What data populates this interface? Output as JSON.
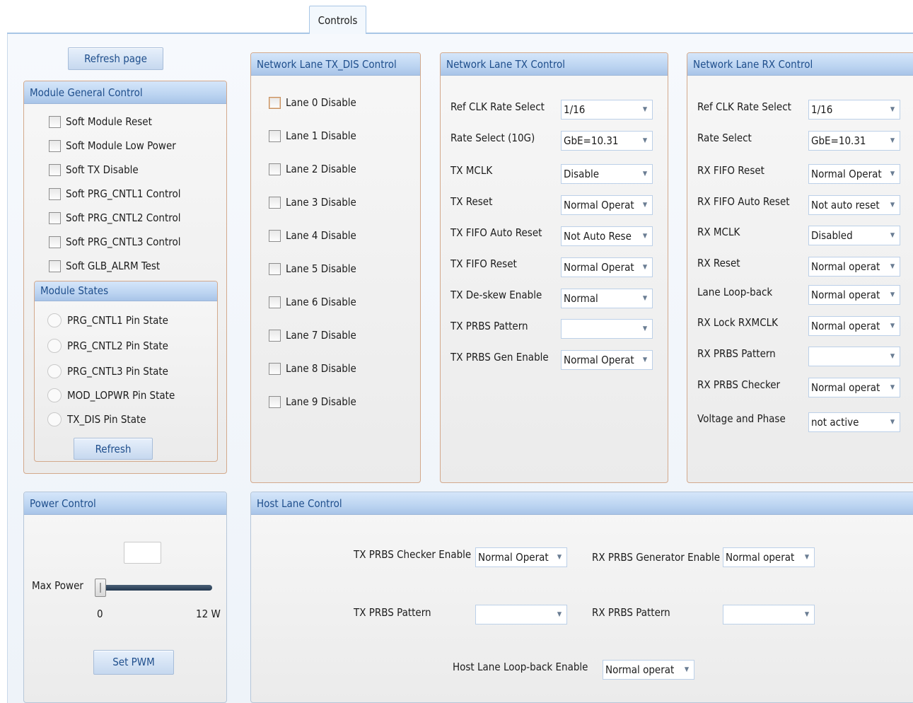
{
  "tabs": [
    {
      "label": "Controls"
    }
  ],
  "refresh_page_label": "Refresh page",
  "module_general": {
    "title": "Module General Control",
    "checkboxes": [
      "Soft Module Reset",
      "Soft Module Low Power",
      "Soft TX Disable",
      "Soft PRG_CNTL1 Control",
      "Soft PRG_CNTL2 Control",
      "Soft PRG_CNTL3 Control",
      "Soft GLB_ALRM Test"
    ]
  },
  "module_states": {
    "title": "Module States",
    "radios": [
      "PRG_CNTL1 Pin State",
      "PRG_CNTL2 Pin State",
      "PRG_CNTL3 Pin State",
      "MOD_LOPWR Pin State",
      "TX_DIS Pin State"
    ],
    "refresh_label": "Refresh"
  },
  "power_control": {
    "title": "Power Control",
    "max_power_label": "Max Power",
    "min_label": "0",
    "max_label": "12 W",
    "set_pwm_label": "Set PWM",
    "value": "",
    "slider_fraction": 0
  },
  "tx_dis": {
    "title": "Network Lane TX_DIS Control",
    "lanes": [
      "Lane 0 Disable",
      "Lane 1 Disable",
      "Lane 2 Disable",
      "Lane 3 Disable",
      "Lane 4 Disable",
      "Lane 5 Disable",
      "Lane 6 Disable",
      "Lane 7 Disable",
      "Lane 8 Disable",
      "Lane 9 Disable"
    ]
  },
  "tx_control": {
    "title": "Network Lane TX Control",
    "rows": [
      {
        "label": "Ref CLK Rate Select",
        "value": "1/16"
      },
      {
        "label": "Rate Select (10G)",
        "value": "GbE=10.31"
      },
      {
        "label": "TX MCLK",
        "value": "Disable"
      },
      {
        "label": "TX Reset",
        "value": "Normal Operat"
      },
      {
        "label": "TX FIFO Auto Reset",
        "value": "Not Auto Rese"
      },
      {
        "label": "TX FIFO Reset",
        "value": "Normal Operat"
      },
      {
        "label": "TX De-skew Enable",
        "value": "Normal"
      },
      {
        "label": "TX PRBS Pattern",
        "value": ""
      },
      {
        "label": "TX PRBS Gen Enable",
        "value": "Normal Operat"
      }
    ]
  },
  "rx_control": {
    "title": "Network Lane RX Control",
    "rows": [
      {
        "label": "Ref CLK Rate Select",
        "value": "1/16"
      },
      {
        "label": "Rate Select",
        "value": "GbE=10.31"
      },
      {
        "label": "RX FIFO Reset",
        "value": "Normal Operat"
      },
      {
        "label": "RX FIFO Auto Reset",
        "value": "Not auto reset"
      },
      {
        "label": "RX MCLK",
        "value": "Disabled"
      },
      {
        "label": "RX Reset",
        "value": "Normal operat"
      },
      {
        "label": "Lane Loop-back",
        "value": "Normal operat"
      },
      {
        "label": "RX Lock RXMCLK",
        "value": "Normal operat"
      },
      {
        "label": "RX PRBS Pattern",
        "value": ""
      },
      {
        "label": "RX PRBS Checker",
        "value": "Normal operat"
      },
      {
        "label": "Voltage and Phase",
        "value": "not active"
      }
    ]
  },
  "host_lane": {
    "title": "Host Lane Control",
    "tx_checker": {
      "label": "TX PRBS Checker Enable",
      "value": "Normal Operat"
    },
    "rx_generator": {
      "label": "RX PRBS Generator Enable",
      "value": "Normal operat"
    },
    "tx_pattern": {
      "label": "TX PRBS Pattern",
      "value": ""
    },
    "rx_pattern": {
      "label": "RX PRBS Pattern",
      "value": ""
    },
    "loopback": {
      "label": "Host Lane Loop-back Enable",
      "value": "Normal operat"
    }
  }
}
